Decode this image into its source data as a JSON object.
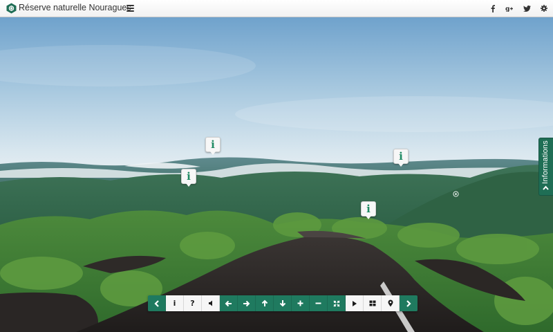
{
  "header": {
    "title": "Réserve naturelle Nouragues",
    "social": [
      "facebook-icon",
      "google-plus-icon",
      "twitter-icon",
      "settings-icon"
    ]
  },
  "side_tab": {
    "label": "Informations"
  },
  "hotspots": [
    "info-hotspot",
    "info-hotspot",
    "info-hotspot",
    "info-hotspot"
  ],
  "controls": {
    "buttons": [
      "collapse-left",
      "info",
      "help",
      "sound",
      "pan-left",
      "pan-right",
      "pan-up",
      "pan-down",
      "zoom-in",
      "zoom-out",
      "fullscreen",
      "autoplay",
      "thumbnails",
      "map",
      "next"
    ],
    "help_glyph": "?",
    "info_glyph": "i"
  },
  "colors": {
    "accent": "#1f7a5f",
    "accent_dark": "#1f6e55",
    "hotspot_glyph": "#1f8a63"
  }
}
